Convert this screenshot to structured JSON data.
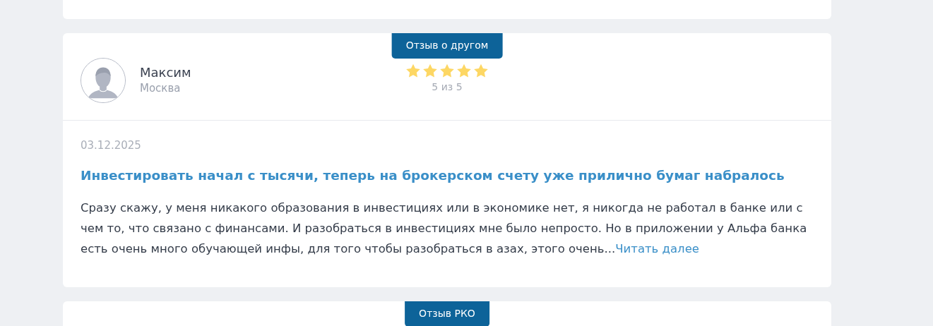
{
  "reviews": [
    {
      "tag": "Отзыв о другом",
      "author": {
        "name": "Максим",
        "city": "Москва"
      },
      "stars": 5,
      "rating_text": "5 из 5",
      "date": "03.12.2025",
      "title": "Инвестировать начал с тысячи, теперь на брокерском счету уже прилично бумаг набралось",
      "text": "Сразу скажу, у меня никакого образования в инвестициях или в экономике нет, я никогда не работал в банке или с чем то, что связано с финансами. И разобраться в инвестициях мне было непросто. Но в приложении у Альфа банка есть очень много обучающей инфы, для того чтобы разобраться в азах, этого очень...",
      "read_more": "Читать далее"
    },
    {
      "tag": "Отзыв РКО"
    }
  ]
}
